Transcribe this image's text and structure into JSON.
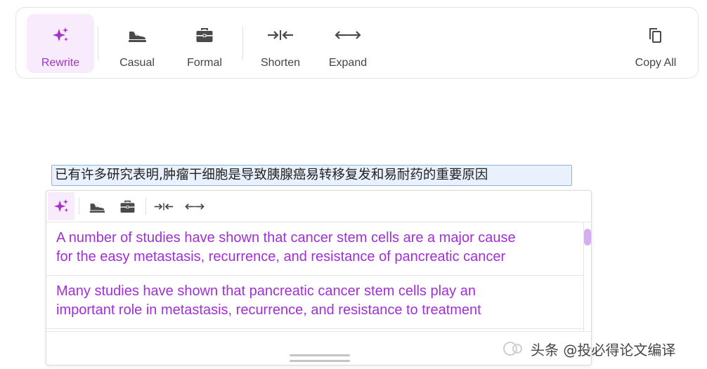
{
  "toolbar": {
    "buttons": [
      {
        "label": "Rewrite",
        "icon": "sparkle-icon",
        "active": true
      },
      {
        "label": "Casual",
        "icon": "sneaker-icon"
      },
      {
        "label": "Formal",
        "icon": "briefcase-icon"
      },
      {
        "label": "Shorten",
        "icon": "arrows-inward-icon"
      },
      {
        "label": "Expand",
        "icon": "arrows-outward-icon"
      },
      {
        "label": "Copy All",
        "icon": "copy-icon"
      }
    ]
  },
  "source_text": "已有许多研究表明,肿瘤干细胞是导致胰腺癌易转移复发和易耐药的重要原因",
  "popup": {
    "results": [
      "A number of studies have shown that cancer stem cells are a major cause for the easy metastasis, recurrence, and resistance of pancreatic cancer",
      "Many studies have shown that pancreatic cancer stem cells play an important role in metastasis, recurrence, and resistance to treatment"
    ]
  },
  "watermark": {
    "text": "头条 @投必得论文编译"
  },
  "colors": {
    "accent": "#a532c9",
    "accent_bg": "#f8ebfb",
    "result_text": "#a12fd6",
    "selection_bg": "#e9f1fd",
    "scroll_thumb": "#d3aef0"
  }
}
